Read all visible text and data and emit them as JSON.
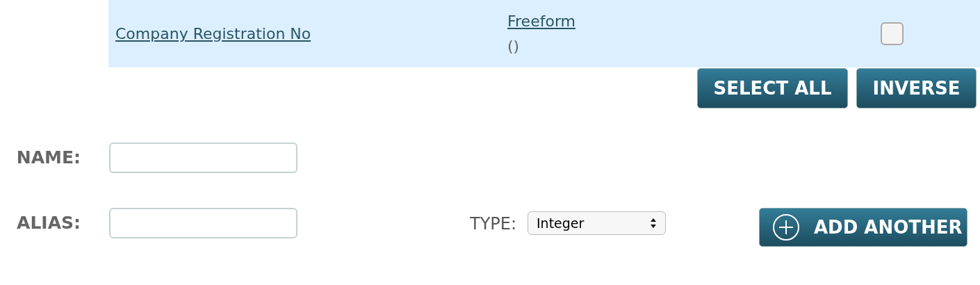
{
  "row": {
    "name": "Company Registration No",
    "type": "Freeform",
    "type_detail": "()",
    "checked": false
  },
  "row_buttons": [
    "SELECT ALL",
    "INVERSE"
  ],
  "fields": [
    {
      "label": "NAME:"
    },
    {
      "label": "ALIAS:"
    }
  ],
  "type_field": {
    "label": "TYPE:",
    "value": "Integer"
  },
  "add_button": {
    "label": "ADD ANOTHER"
  }
}
